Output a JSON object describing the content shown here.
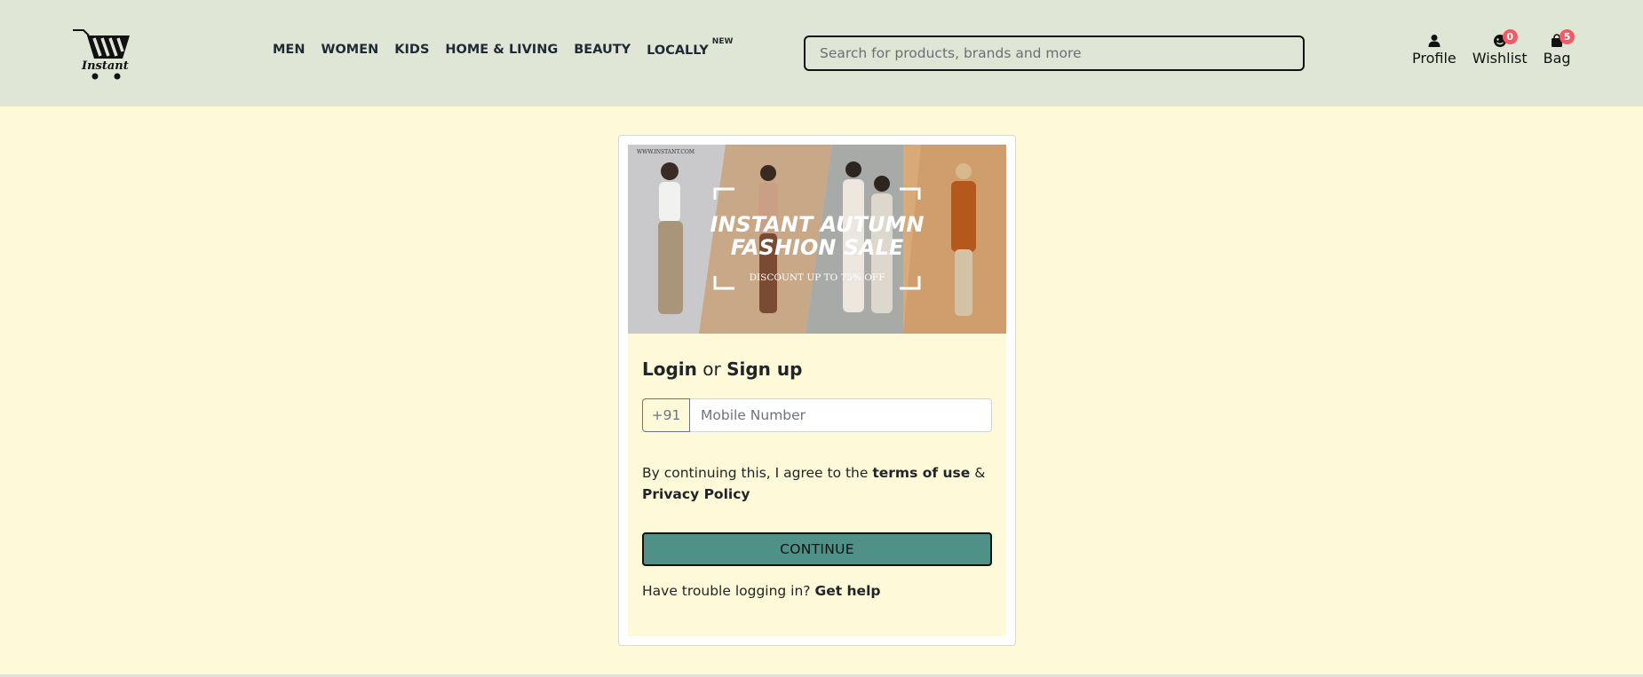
{
  "brand": {
    "name": "Instant"
  },
  "nav": {
    "items": [
      {
        "label": "MEN"
      },
      {
        "label": "WOMEN"
      },
      {
        "label": "KIDS"
      },
      {
        "label": "HOME & LIVING"
      },
      {
        "label": "BEAUTY"
      },
      {
        "label": "LOCALLY",
        "tag": "NEW"
      }
    ]
  },
  "search": {
    "placeholder": "Search for products, brands and more",
    "value": ""
  },
  "actions": {
    "profile": {
      "label": "Profile",
      "icon": "person-icon"
    },
    "wishlist": {
      "label": "Wishlist",
      "icon": "heart-icon",
      "count": "0"
    },
    "bag": {
      "label": "Bag",
      "icon": "bag-icon",
      "count": "5"
    }
  },
  "banner": {
    "site": "WWW.INSTANT.COM",
    "headline_line1": "INSTANT AUTUMN",
    "headline_line2": "FASHION SALE",
    "subtext": "DISCOUNT UP TO 75% OFF"
  },
  "login": {
    "title_login": "Login",
    "title_or": "or",
    "title_signup": "Sign up",
    "country_code": "+91",
    "mobile_placeholder": "Mobile Number",
    "terms_prefix": "By continuing this, I agree to the",
    "terms_link": "terms of use",
    "terms_amp": "&",
    "privacy_link": "Privacy Policy",
    "continue_label": "CONTINUE",
    "help_prefix": "Have trouble logging in?",
    "help_link": "Get help"
  },
  "colors": {
    "header_bg": "#e0e6d6",
    "page_bg": "#fef9d8",
    "button_bg": "#4f9087",
    "badge": "#f15b66"
  }
}
